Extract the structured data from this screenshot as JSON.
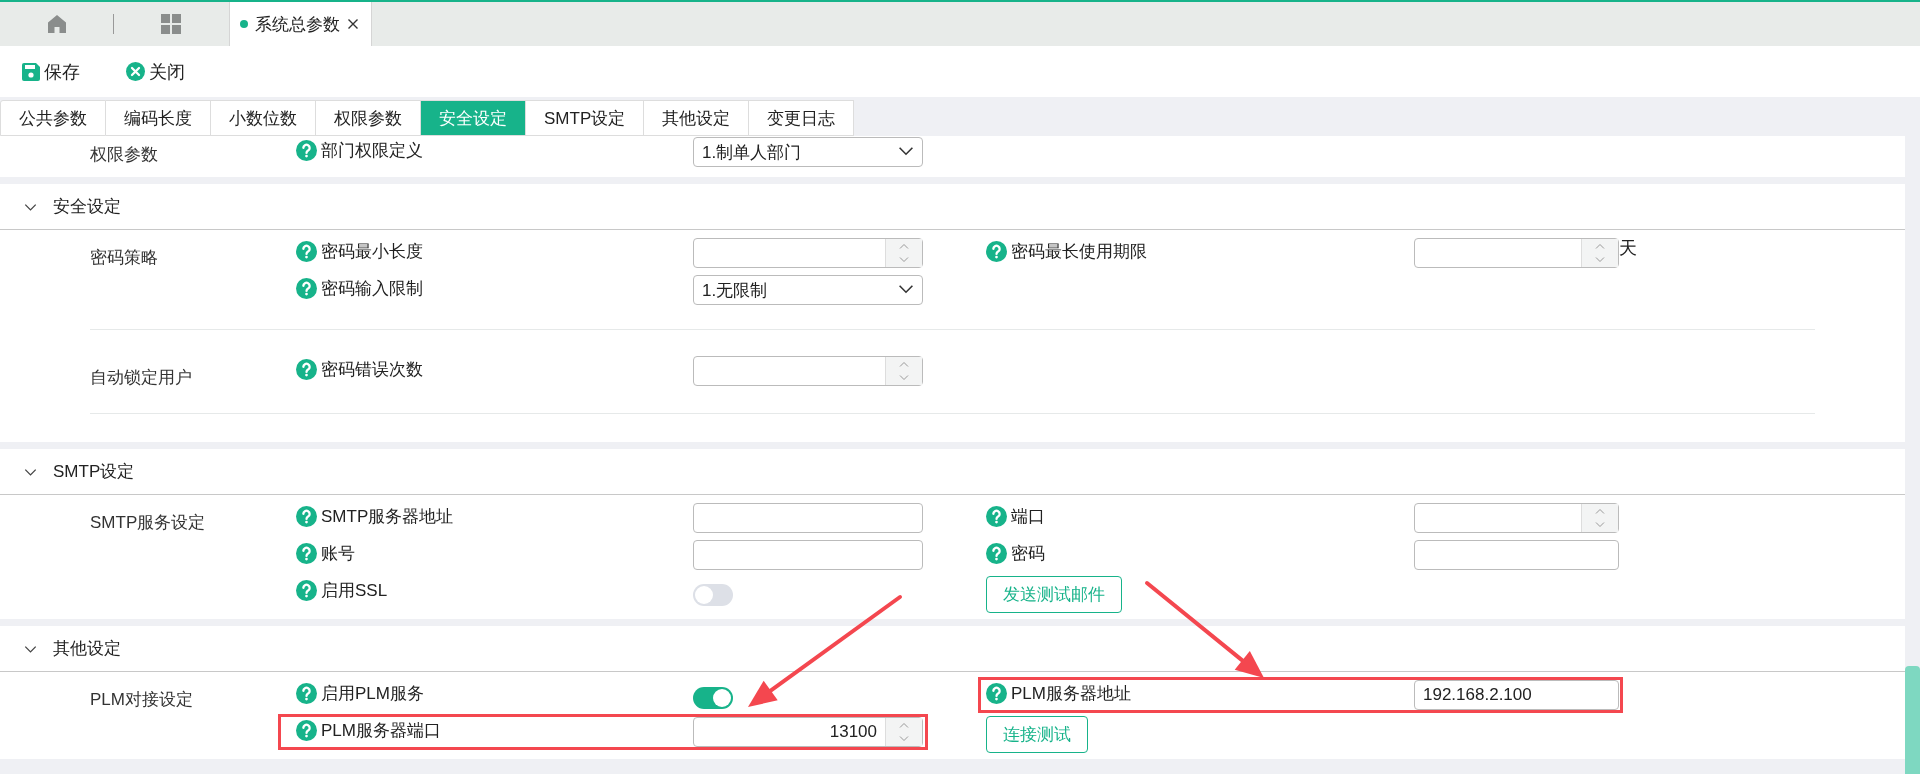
{
  "top_tabs": [
    {
      "kind": "home",
      "selected": false
    },
    {
      "kind": "apps",
      "selected": false
    },
    {
      "kind": "page",
      "label": "系统总参数",
      "selected": true
    }
  ],
  "toolbar": [
    {
      "kind": "save",
      "label": "保存"
    },
    {
      "kind": "close",
      "label": "关闭"
    }
  ],
  "tabs": [
    {
      "label": "公共参数",
      "selected": false
    },
    {
      "label": "编码长度",
      "selected": false
    },
    {
      "label": "小数位数",
      "selected": false
    },
    {
      "label": "权限参数",
      "selected": false
    },
    {
      "label": "安全设定",
      "selected": true
    },
    {
      "label": "SMTP设定",
      "selected": false
    },
    {
      "label": "其他设定",
      "selected": false
    },
    {
      "label": "变更日志",
      "selected": false
    }
  ],
  "sections": [
    {
      "groups": [
        {
          "label": "权限参数",
          "left": [
            {
              "kind": "select",
              "label": "部门权限定义",
              "value": "1.制单人部门"
            }
          ]
        }
      ]
    },
    {
      "title": "安全设定",
      "expanded": true,
      "groups": [
        {
          "label": "密码策略",
          "left": [
            {
              "kind": "spin",
              "label": "密码最小长度"
            },
            {
              "kind": "select",
              "label": "密码输入限制",
              "value": "1.无限制"
            }
          ],
          "right": [
            {
              "kind": "spin",
              "label": "密码最长使用期限",
              "unit": "天"
            }
          ]
        },
        {
          "label": "自动锁定用户",
          "left": [
            {
              "kind": "spin",
              "label": "密码错误次数"
            }
          ]
        }
      ]
    },
    {
      "title": "SMTP设定",
      "expanded": true,
      "groups": [
        {
          "label": "SMTP服务设定",
          "left": [
            {
              "kind": "text",
              "label": "SMTP服务器地址"
            },
            {
              "kind": "text",
              "label": "账号"
            },
            {
              "kind": "switch",
              "label": "启用SSL",
              "on": false
            }
          ],
          "right": [
            {
              "kind": "spin",
              "label": "端口"
            },
            {
              "kind": "text",
              "label": "密码"
            },
            {
              "kind": "button",
              "label": "发送测试邮件"
            }
          ]
        }
      ]
    },
    {
      "title": "其他设定",
      "expanded": true,
      "groups": [
        {
          "label": "PLM对接设定",
          "left": [
            {
              "kind": "switch",
              "label": "启用PLM服务",
              "on": true
            },
            {
              "kind": "spin",
              "label": "PLM服务器端口",
              "value": "13100",
              "highlighted": true
            }
          ],
          "right": [
            {
              "kind": "text",
              "label": "PLM服务器地址",
              "value": "192.168.2.100",
              "highlighted": true
            },
            {
              "kind": "button",
              "label": "连接测试"
            }
          ]
        }
      ]
    }
  ]
}
